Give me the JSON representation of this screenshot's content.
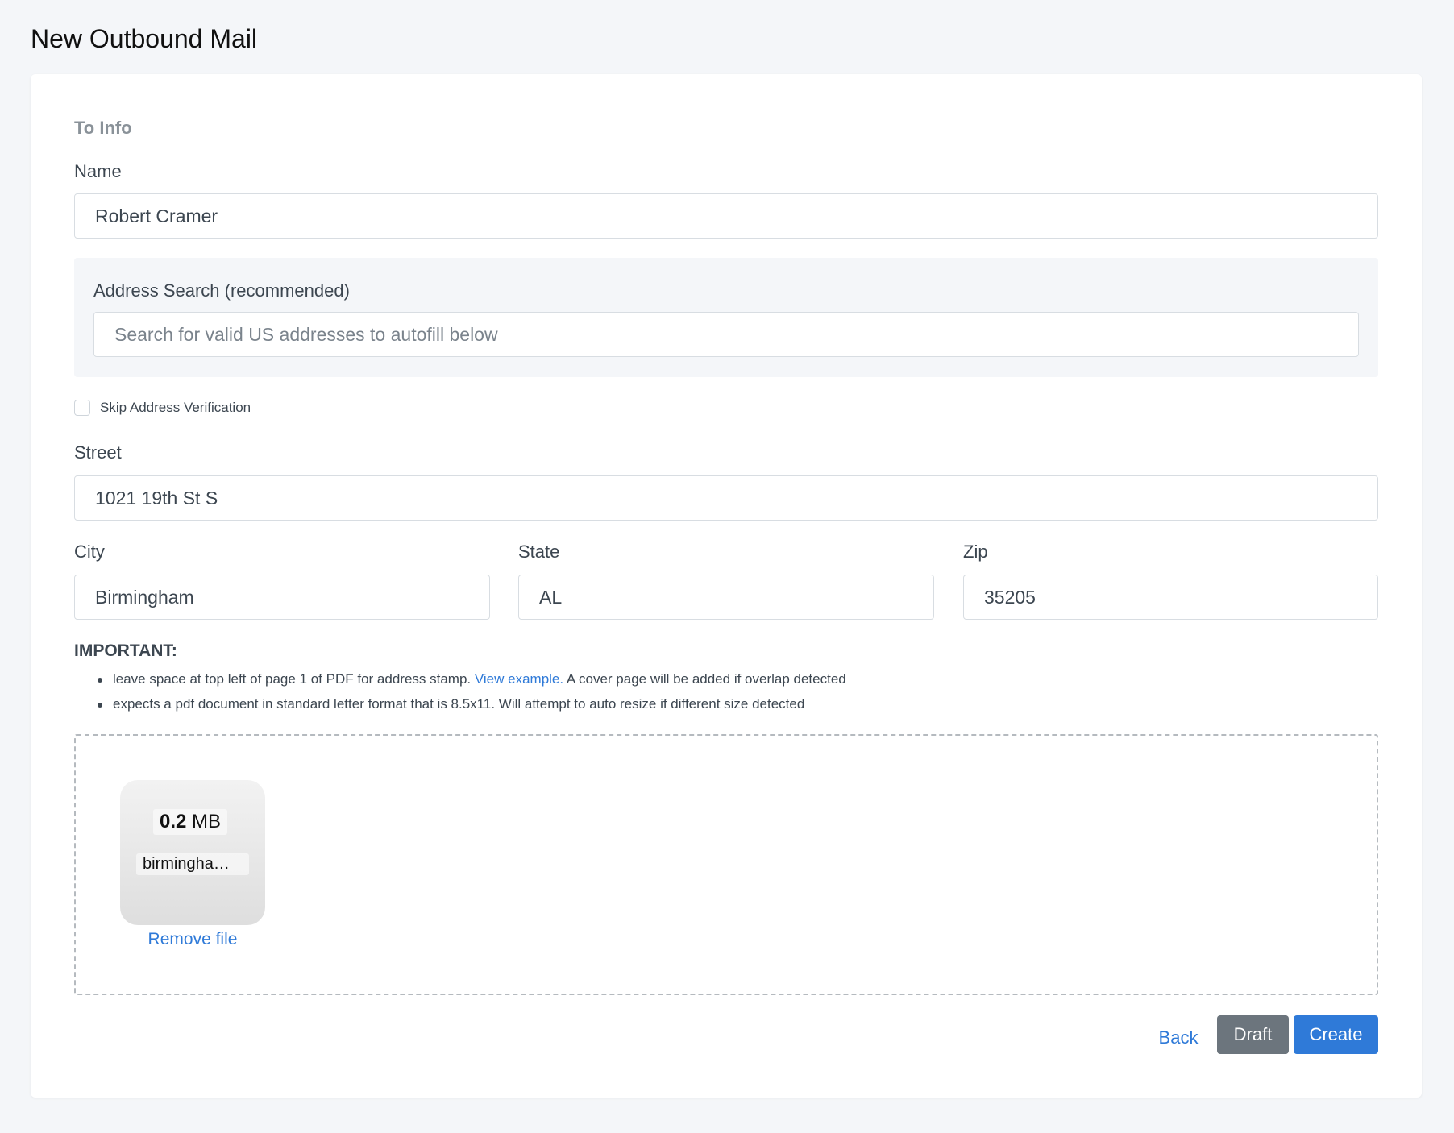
{
  "page": {
    "title": "New Outbound Mail"
  },
  "to_info": {
    "section_title": "To Info",
    "name": {
      "label": "Name",
      "value": "Robert Cramer"
    },
    "address_search": {
      "label": "Address Search (recommended)",
      "placeholder": "Search for valid US addresses to autofill below"
    },
    "skip_verification": {
      "label": "Skip Address Verification",
      "checked": false
    },
    "street": {
      "label": "Street",
      "value": "1021 19th St S"
    },
    "city": {
      "label": "City",
      "value": "Birmingham"
    },
    "state": {
      "label": "State",
      "value": "AL"
    },
    "zip": {
      "label": "Zip",
      "value": "35205"
    }
  },
  "important": {
    "heading": "IMPORTANT:",
    "note1": {
      "before": "leave space at top left of page 1 of PDF for address stamp. ",
      "link": "View example.",
      "after": " A cover page will be added if overlap detected"
    },
    "note2": "expects a pdf document in standard letter format that is 8.5x11. Will attempt to auto resize if different size detected"
  },
  "upload": {
    "file_size_number": "0.2",
    "file_size_unit": "MB",
    "file_name": "birmingham…",
    "remove_label": "Remove file"
  },
  "actions": {
    "back_label": "Back",
    "draft_label": "Draft",
    "create_label": "Create"
  },
  "colors": {
    "accent": "#2f7ad8",
    "draft": "#6c757d",
    "background": "#f4f6f9"
  }
}
